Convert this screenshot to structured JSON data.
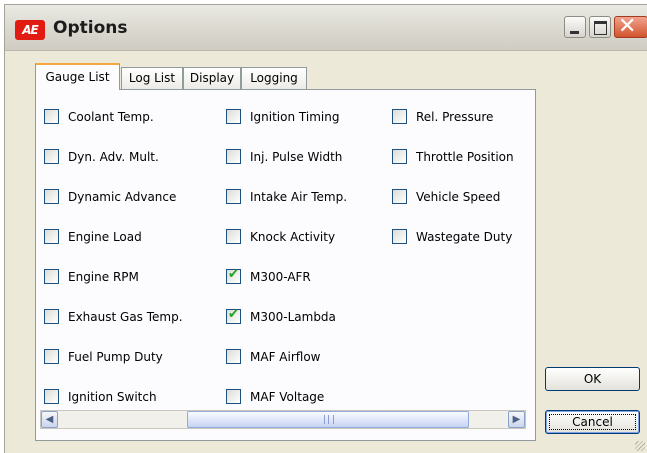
{
  "window": {
    "title": "Options",
    "app_icon_text": "AE"
  },
  "title_buttons": {
    "minimize_icon": "minimize-icon",
    "maximize_icon": "maximize-icon",
    "close_icon": "close-icon",
    "close_glyph": "✕"
  },
  "tabs": [
    {
      "label": "Gauge List",
      "active": true
    },
    {
      "label": "Log List",
      "active": false
    },
    {
      "label": "Display",
      "active": false
    },
    {
      "label": "Logging",
      "active": false
    }
  ],
  "gauge_list": {
    "columns": [
      [
        {
          "label": "Coolant Temp.",
          "checked": false
        },
        {
          "label": "Dyn. Adv. Mult.",
          "checked": false
        },
        {
          "label": "Dynamic Advance",
          "checked": false
        },
        {
          "label": "Engine Load",
          "checked": false
        },
        {
          "label": "Engine RPM",
          "checked": false
        },
        {
          "label": "Exhaust Gas Temp.",
          "checked": false
        },
        {
          "label": "Fuel Pump Duty",
          "checked": false
        },
        {
          "label": "Ignition Switch",
          "checked": false
        }
      ],
      [
        {
          "label": "Ignition Timing",
          "checked": false
        },
        {
          "label": "Inj. Pulse Width",
          "checked": false
        },
        {
          "label": "Intake Air Temp.",
          "checked": false
        },
        {
          "label": "Knock Activity",
          "checked": false
        },
        {
          "label": "M300-AFR",
          "checked": true
        },
        {
          "label": "M300-Lambda",
          "checked": true
        },
        {
          "label": "MAF Airflow",
          "checked": false
        },
        {
          "label": "MAF Voltage",
          "checked": false
        }
      ],
      [
        {
          "label": "Rel. Pressure",
          "checked": false
        },
        {
          "label": "Throttle Position",
          "checked": false
        },
        {
          "label": "Vehicle Speed",
          "checked": false
        },
        {
          "label": "Wastegate Duty",
          "checked": false
        }
      ]
    ],
    "check_glyph": "✔"
  },
  "scrollbar": {
    "left_arrow": "◀",
    "right_arrow": "▶"
  },
  "buttons": {
    "ok_label": "OK",
    "cancel_label": "Cancel"
  }
}
